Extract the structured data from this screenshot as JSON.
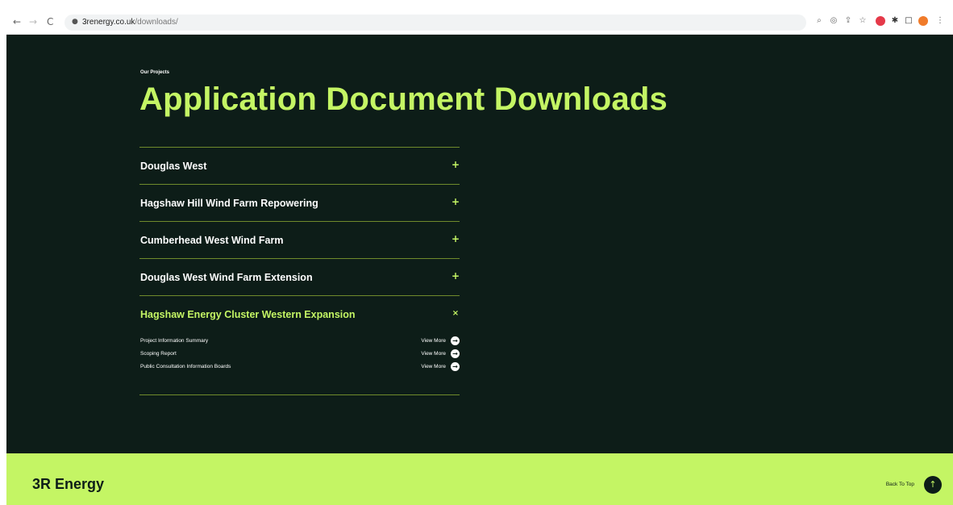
{
  "browser": {
    "url_domain": "3renergy.co.uk",
    "url_path": "/downloads/",
    "back_icon": "←",
    "forward_icon": "→",
    "reload_icon": "C",
    "lock_icon": "🔒"
  },
  "page": {
    "eyebrow": "Our Projects",
    "title": "Application Document Downloads"
  },
  "accordion": [
    {
      "title": "Douglas West",
      "toggle": "+"
    },
    {
      "title": "Hagshaw Hill Wind Farm Repowering",
      "toggle": "+"
    },
    {
      "title": "Cumberhead West Wind Farm",
      "toggle": "+"
    },
    {
      "title": "Douglas West Wind Farm Extension",
      "toggle": "+"
    },
    {
      "title": "Hagshaw Energy Cluster Western Expansion",
      "toggle": "×",
      "documents": [
        {
          "name": "Project Information Summary",
          "link": "View More"
        },
        {
          "name": "Scoping Report",
          "link": "View More"
        },
        {
          "name": "Public Consultation Information Boards",
          "link": "View More"
        }
      ]
    }
  ],
  "footer": {
    "logo": "3R Energy",
    "back_to_top": "Back To Top",
    "back_to_top_icon": "↑"
  },
  "colors": {
    "background": "#0d1d18",
    "accent": "#c4f564",
    "divider": "#6f8a2c"
  }
}
